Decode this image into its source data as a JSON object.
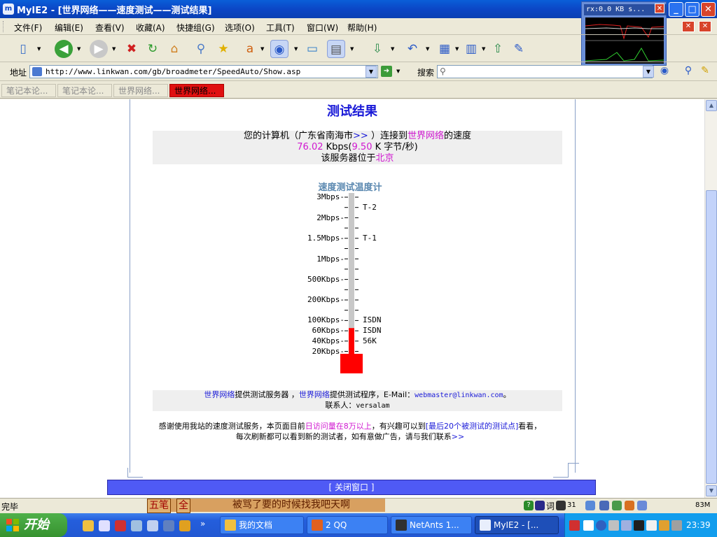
{
  "window": {
    "app_icon": "m",
    "title": "MyIE2 - [世界网络——速度测试——测试结果]",
    "minimize": "_",
    "maximize": "□",
    "close": "✕"
  },
  "netmon": {
    "label": "rx:0.0 KB s...",
    "close": "✕"
  },
  "menu": {
    "items": [
      "文件(F)",
      "编辑(E)",
      "查看(V)",
      "收藏(A)",
      "快捷组(G)",
      "选项(O)",
      "工具(T)",
      "窗口(W)",
      "帮助(H)"
    ]
  },
  "address": {
    "label": "地址",
    "url": "http://www.linkwan.com/gb/broadmeter/SpeedAuto/Show.asp",
    "search_label": "搜索"
  },
  "tabs": [
    "笔记本论...",
    "笔记本论...",
    "世界网络...",
    "世界网络..."
  ],
  "page": {
    "title": "测试结果",
    "info_line1_a": "您的计算机（广东省南海市",
    "info_line1_link": ">>",
    "info_line1_b": " ）连接到",
    "info_line1_site": "世界网络",
    "info_line1_c": "的速度",
    "speed_kbps": "76.02",
    "speed_unit1": " Kbps(",
    "speed_kBs": "9.50",
    "speed_unit2": " K 字节/秒)",
    "server_prefix": "该服务器位于",
    "server_city": "北京",
    "meter_title": "速度测试温度计",
    "meter_ticks": [
      "3Mbps-",
      "2Mbps-",
      "1.5Mbps-",
      "1Mbps-",
      "500Kbps-",
      "200Kbps-",
      "100Kbps-",
      "60Kbps-",
      "40Kbps-",
      "20Kbps-"
    ],
    "meter_right": [
      "T-2",
      "T-1",
      "ISDN",
      "ISDN",
      "56K"
    ],
    "credits_site1": "世界网络",
    "credits_a": "提供测试服务器 ，",
    "credits_site2": "世界网络",
    "credits_b": "提供测试程序，E-Mail：",
    "credits_email": "webmaster@linkwan.com",
    "credits_c": "。",
    "contact_label": "联系人：",
    "contact_name": "versalam",
    "thanks_a": "感谢使用我站的速度测试服务，本页面目前",
    "thanks_hl": "日访问量在8万以上",
    "thanks_b": "，有兴趣可以到",
    "thanks_link": "[最后20个被测试的测试点]",
    "thanks_c": "看看，",
    "thanks_line2": "每次刷新都可以看到新的测试者，如有意做广告，请与我们联系",
    "thanks_link2": ">>",
    "close_button": "[ 关闭窗口 ]"
  },
  "meter_data": {
    "level_fraction": 0.16
  },
  "status": {
    "text": "完毕",
    "ime_mode": "五笔",
    "ime_width": "全",
    "ime_text": "被骂了要的时候找我吧天啊",
    "ime_ci": "词",
    "count": "31",
    "mem": "83M"
  },
  "taskbar": {
    "start": "开始",
    "tasks": [
      "我的文档",
      "2 QQ",
      "NetAnts 1...",
      "MyIE2 - [..."
    ],
    "time": "23:39"
  },
  "colors": {
    "accent": "#1a1ad8",
    "highlight": "#d018d0",
    "mercury": "#ff0000"
  }
}
